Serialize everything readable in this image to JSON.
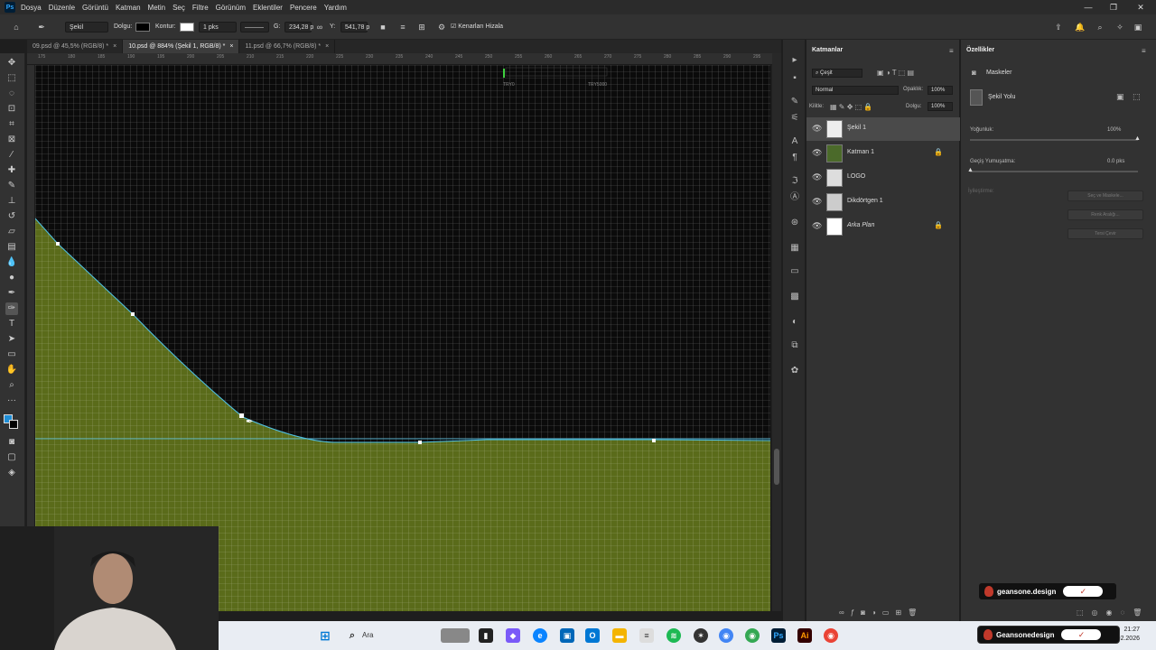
{
  "menu": [
    "Dosya",
    "Düzenle",
    "Görüntü",
    "Katman",
    "Metin",
    "Seç",
    "Filtre",
    "Görünüm",
    "Eklentiler",
    "Pencere",
    "Yardım"
  ],
  "options": {
    "shape_mode": "Şekil",
    "fill_label": "Dolgu:",
    "stroke_label": "Kontur:",
    "stroke_width": "1 pks",
    "w_label": "G:",
    "w_value": "234,28 p",
    "h_label": "Y:",
    "h_value": "541,78 p",
    "align_edges": "Kenarları Hizala"
  },
  "tabs": [
    {
      "label": "09.psd @ 45,5% (RGB/8) *",
      "active": false
    },
    {
      "label": "10.psd @ 884% (Şekil 1, RGB/8) *",
      "active": true
    },
    {
      "label": "11.psd @ 66,7% (RGB/8) *",
      "active": false
    }
  ],
  "ruler_ticks": [
    "175",
    "180",
    "185",
    "190",
    "195",
    "200",
    "205",
    "210",
    "215",
    "220",
    "225",
    "230",
    "235",
    "240",
    "245",
    "250",
    "255",
    "260",
    "265",
    "270",
    "275",
    "280",
    "285",
    "290",
    "295"
  ],
  "canvas": {
    "labels": [
      "TRY0",
      "TRY5000"
    ],
    "fill_color": "#5a6b1a",
    "path_color": "#4fc3e8",
    "grid_color": "#ffffff"
  },
  "layers_panel": {
    "title": "Katmanlar",
    "filter": "Çeşit",
    "blend": "Normal",
    "opacity_label": "Opaklık:",
    "opacity": "100%",
    "lock_label": "Kilitle:",
    "fill_label": "Dolgu:",
    "fill": "100%",
    "layers": [
      {
        "name": "Şekil 1",
        "selected": true,
        "locked": false
      },
      {
        "name": "Katman 1",
        "selected": false,
        "locked": true
      },
      {
        "name": "LOGO",
        "selected": false,
        "locked": false
      },
      {
        "name": "Dikdörtgen 1",
        "selected": false,
        "locked": false
      },
      {
        "name": "Arka Plan",
        "selected": false,
        "locked": true
      }
    ]
  },
  "properties_panel": {
    "title": "Özellikler",
    "section": "Maskeler",
    "mask_name": "Şekil Yolu",
    "density_label": "Yoğunluk:",
    "density": "100%",
    "feather_label": "Geçiş Yumuşatma:",
    "feather": "0.0 pks",
    "refine_label": "İyileştirme:",
    "buttons": [
      "Seç ve Maskele...",
      "Renk Aralığı...",
      "Tersi Çevir"
    ]
  },
  "badges": [
    "geansone.design",
    "Geansonedesign"
  ],
  "taskbar": {
    "search": "Ara",
    "time": "21:27",
    "date": "1.02.2026"
  }
}
